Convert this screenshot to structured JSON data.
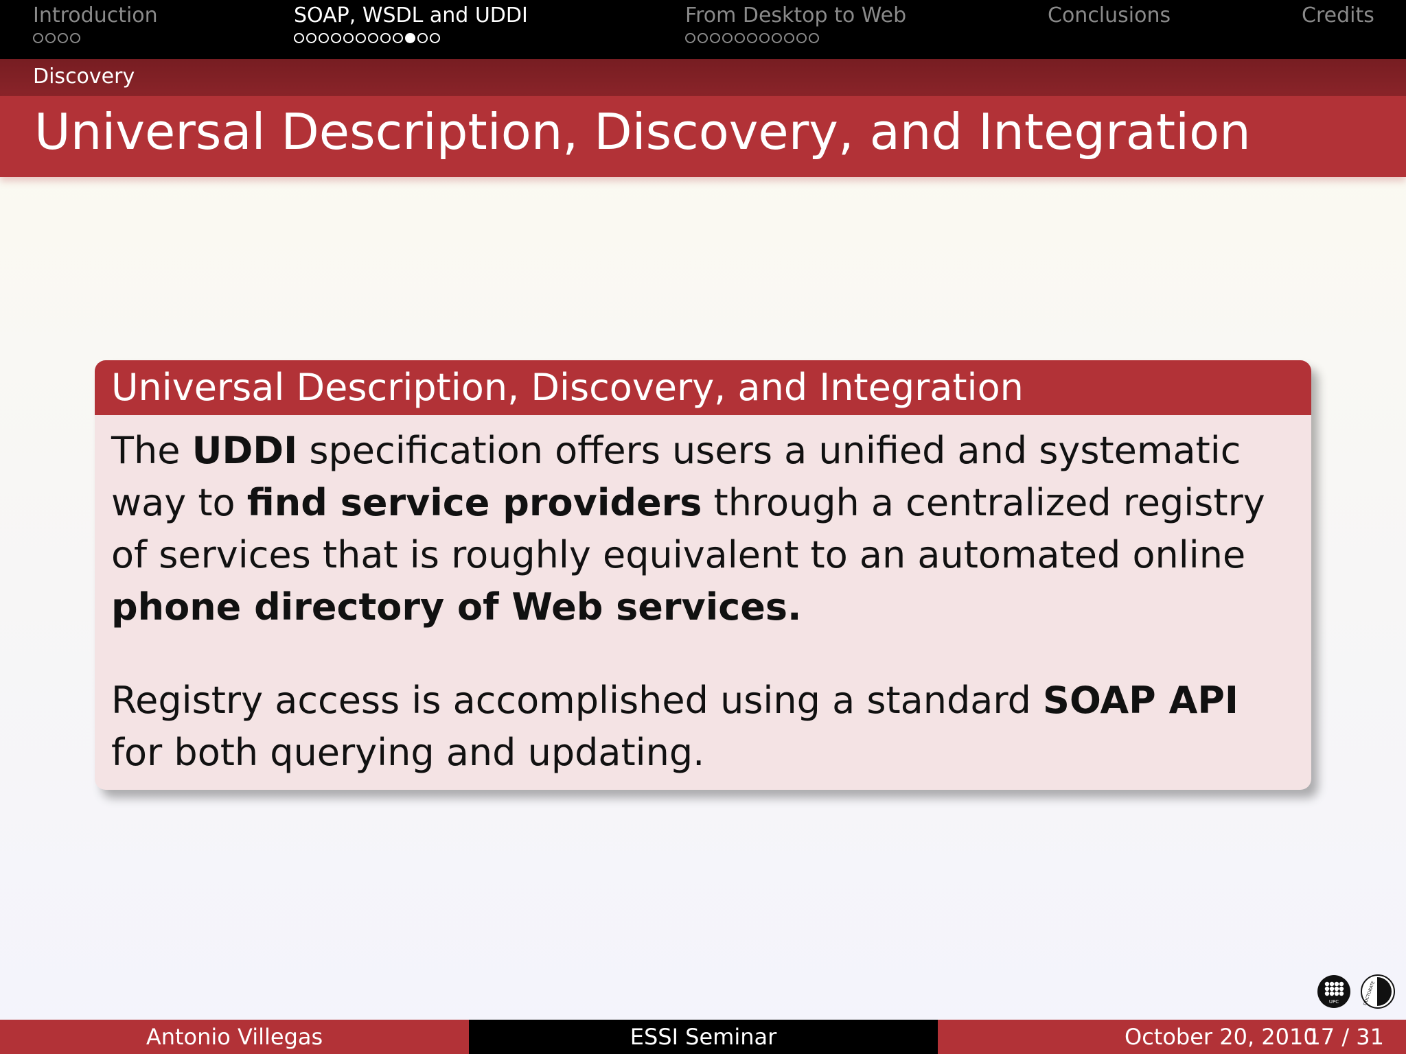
{
  "nav": {
    "sections": [
      {
        "title": "Introduction",
        "dots": [
          0,
          0,
          0,
          0
        ],
        "active": false
      },
      {
        "title": "SOAP, WSDL and UDDI",
        "dots": [
          0,
          0,
          0,
          0,
          0,
          0,
          0,
          0,
          0,
          1,
          0,
          0
        ],
        "active": true
      },
      {
        "title": "From Desktop to Web",
        "dots": [
          0,
          0,
          0,
          0,
          0,
          0,
          0,
          0,
          0,
          0,
          0
        ],
        "active": false
      },
      {
        "title": "Conclusions",
        "dots": [],
        "active": false
      },
      {
        "title": "Credits",
        "dots": [],
        "active": false
      }
    ]
  },
  "subsection": "Discovery",
  "frame_title": "Universal Description, Discovery, and Integration",
  "block": {
    "title": "Universal Description, Discovery, and Integration",
    "p1": {
      "t1": "The ",
      "b1": "UDDI",
      "t2": " specification offers users a unified and systematic way to ",
      "b2": "find service providers",
      "t3": " through a centralized registry of services that is roughly equivalent to an automated online ",
      "b3": "phone directory of Web services."
    },
    "p2": {
      "t1": "Registry access is accomplished using a standard ",
      "b1": "SOAP API",
      "t2": " for both querying and updating."
    }
  },
  "logos": {
    "upc_label": "UPC",
    "doctorate_label": "DOCTORATE"
  },
  "footer": {
    "author": "Antonio Villegas",
    "event": "ESSI Seminar",
    "date": "October 20, 2010",
    "page": "17 / 31"
  },
  "colors": {
    "accent": "#b23237",
    "subnav": "#8a2429",
    "block_body": "#f4e3e4"
  }
}
